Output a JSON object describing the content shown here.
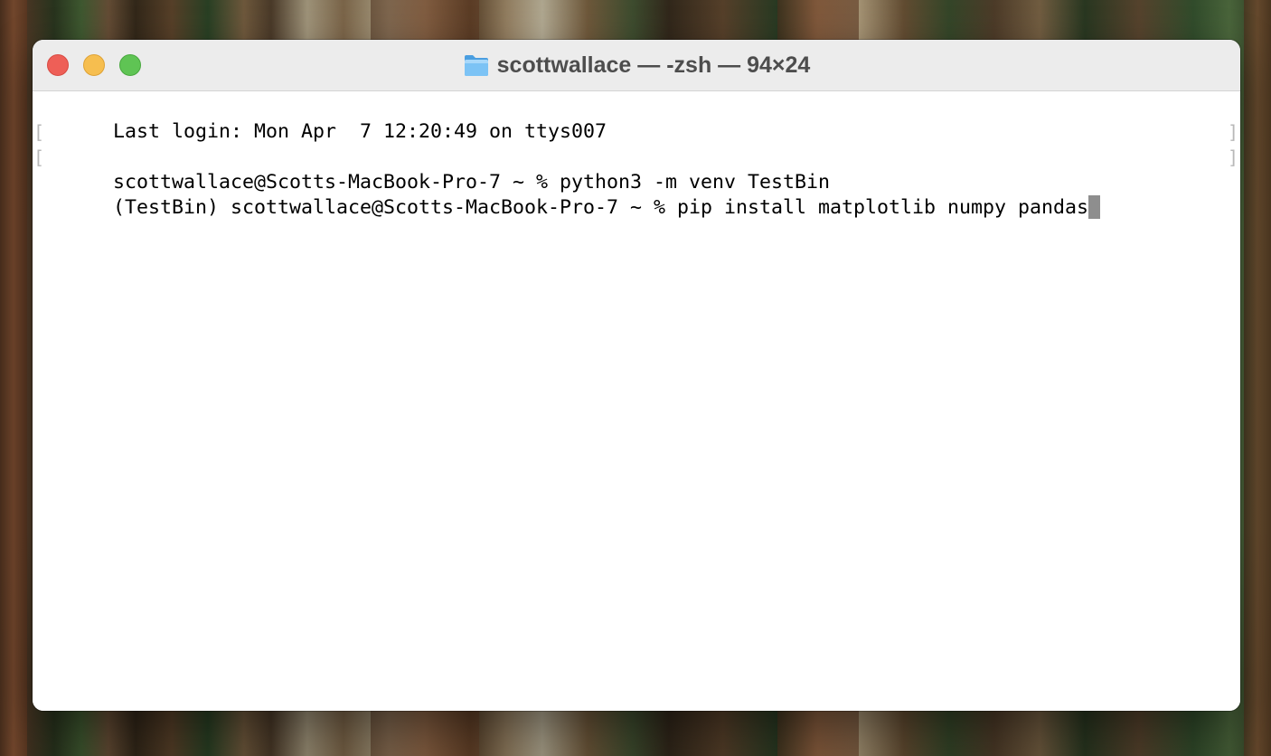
{
  "window": {
    "title": "scottwallace — -zsh — 94×24",
    "title_icon": "folder-icon"
  },
  "terminal": {
    "lines": [
      {
        "text": "Last login: Mon Apr  7 12:20:49 on ttys007",
        "marked": false
      },
      {
        "text": "scottwallace@Scotts-MacBook-Pro-7 ~ % python3 -m venv TestBin",
        "marked": true
      },
      {
        "text": "(TestBin) scottwallace@Scotts-MacBook-Pro-7 ~ % pip install matplotlib numpy pandas",
        "marked": true
      }
    ],
    "mark_left": "[",
    "mark_right": "]"
  },
  "colors": {
    "close": "#ee5f57",
    "minimize": "#f6be4f",
    "maximize": "#5fc454",
    "folder": "#6cb6f0"
  }
}
